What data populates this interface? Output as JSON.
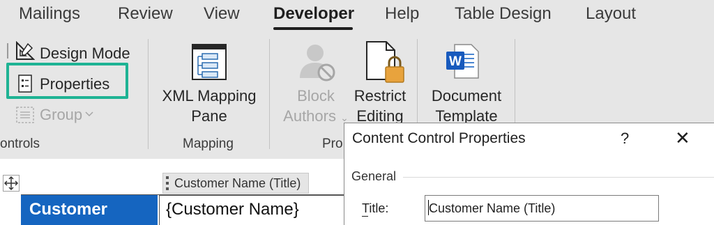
{
  "tabs": [
    "Mailings",
    "Review",
    "View",
    "Developer",
    "Help",
    "Table Design",
    "Layout"
  ],
  "ribbon": {
    "controls_group": {
      "design_mode": "Design Mode",
      "properties": "Properties",
      "group": "Group",
      "label": "ontrols"
    },
    "mapping_group": {
      "xml_line1": "XML Mapping",
      "xml_line2": "Pane",
      "label": "Mapping"
    },
    "protect_group": {
      "block_line1": "Block",
      "block_line2": "Authors",
      "restrict_line1": "Restrict",
      "restrict_line2": "Editing",
      "label": "Pro"
    },
    "templates_group": {
      "doc_line1": "Document",
      "doc_line2": "Template"
    }
  },
  "document": {
    "content_control_tag": "Customer Name (Title)",
    "cell_label": "Customer",
    "cell_value": "{Customer Name}"
  },
  "dialog": {
    "title": "Content Control Properties",
    "help": "?",
    "close": "✕",
    "section": "General",
    "title_field_label": "Title:",
    "title_field_value": "Customer Name (Title)"
  },
  "colors": {
    "ribbon_bg": "#e6e6e6",
    "highlight": "#1fb394",
    "cell_blue": "#1565c0",
    "word_blue": "#185abd",
    "lock_orange": "#e8a33d"
  }
}
